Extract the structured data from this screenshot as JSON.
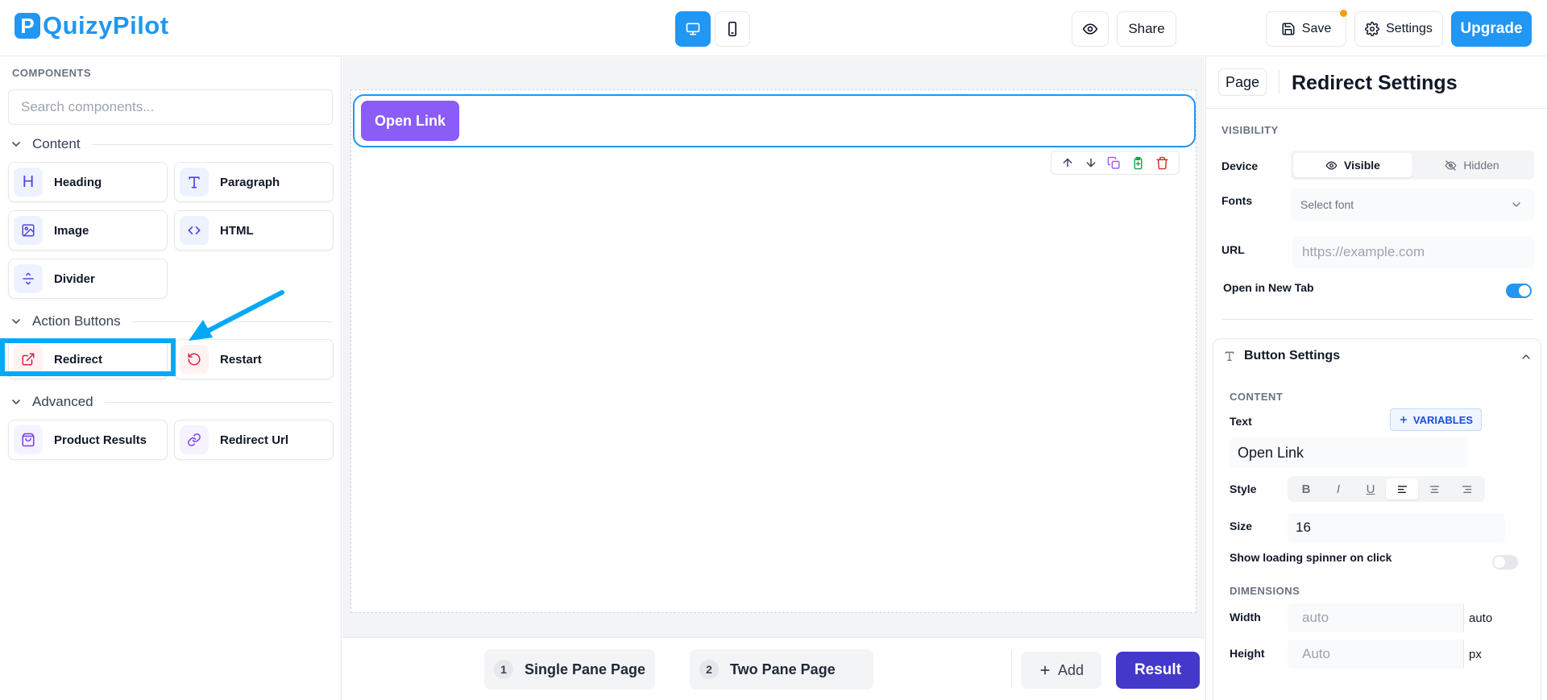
{
  "app": {
    "logo_letter": "P",
    "name": "QuizyPilot"
  },
  "topbar": {
    "device_desktop_icon": "desktop-icon",
    "device_mobile_icon": "mobile-icon",
    "preview_icon": "eye-icon",
    "share_label": "Share",
    "save_label": "Save",
    "settings_label": "Settings",
    "upgrade_label": "Upgrade"
  },
  "left": {
    "heading": "COMPONENTS",
    "search_placeholder": "Search components...",
    "sections": {
      "content": "Content",
      "action": "Action Buttons",
      "advanced": "Advanced"
    },
    "components": {
      "heading": "Heading",
      "paragraph": "Paragraph",
      "image": "Image",
      "html": "HTML",
      "divider": "Divider",
      "redirect": "Redirect",
      "restart": "Restart",
      "product_results": "Product Results",
      "redirect_url": "Redirect Url"
    },
    "heading_icon_letter": "H",
    "paragraph_icon_letter": "T"
  },
  "canvas": {
    "button_label": "Open Link"
  },
  "bottom": {
    "pages": [
      {
        "num": "1",
        "label": "Single Pane Page"
      },
      {
        "num": "2",
        "label": "Two Pane Page"
      }
    ],
    "add_label": "Add",
    "result_label": "Result"
  },
  "right": {
    "page_btn": "Page",
    "title": "Redirect Settings",
    "visibility_caption": "VISIBILITY",
    "device_label": "Device",
    "visible_label": "Visible",
    "hidden_label": "Hidden",
    "fonts_label": "Fonts",
    "fonts_placeholder": "Select font",
    "url_label": "URL",
    "url_placeholder": "https://example.com",
    "open_new_tab_label": "Open in New Tab",
    "open_new_tab": true,
    "button_settings": "Button Settings",
    "content_caption": "CONTENT",
    "text_label": "Text",
    "variables_label": "VARIABLES",
    "text_value": "Open Link",
    "style_label": "Style",
    "size_label": "Size",
    "size_value": "16",
    "spinner_label": "Show loading spinner on click",
    "spinner_on": false,
    "dimensions_caption": "DIMENSIONS",
    "width_label": "Width",
    "width_placeholder": "auto",
    "width_unit": "auto",
    "height_label": "Height",
    "height_placeholder": "Auto",
    "height_unit": "px"
  },
  "colors": {
    "primary": "#2196f3",
    "button_purple": "#8b5cf6",
    "result_indigo": "#4338ca",
    "highlight": "#03a9f4"
  }
}
